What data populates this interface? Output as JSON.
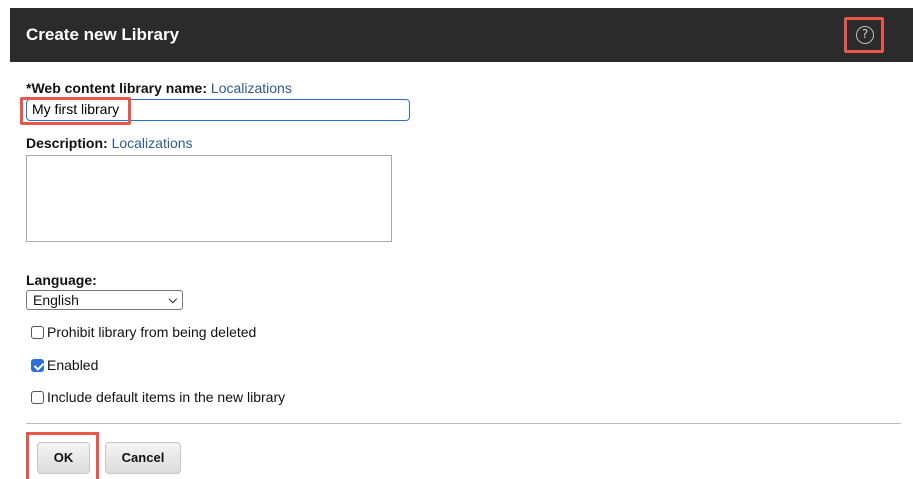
{
  "dialog": {
    "title": "Create new Library",
    "help_icon": "question-circle-icon"
  },
  "form": {
    "name_label": "*Web content library name:",
    "name_localizations": "Localizations",
    "name_value": "My first library",
    "description_label": "Description:",
    "description_localizations": "Localizations",
    "description_value": "",
    "language_label": "Language:",
    "language_value": "English",
    "checkboxes": [
      {
        "label": "Prohibit library from being deleted",
        "checked": false
      },
      {
        "label": "Enabled",
        "checked": true
      },
      {
        "label": "Include default items in the new library",
        "checked": false
      }
    ]
  },
  "buttons": {
    "ok": "OK",
    "cancel": "Cancel"
  },
  "colors": {
    "header_bg": "#2b2b2b",
    "highlight": "#e8574c",
    "link": "#2e5b8f",
    "checkbox_checked": "#2a6fdb"
  }
}
